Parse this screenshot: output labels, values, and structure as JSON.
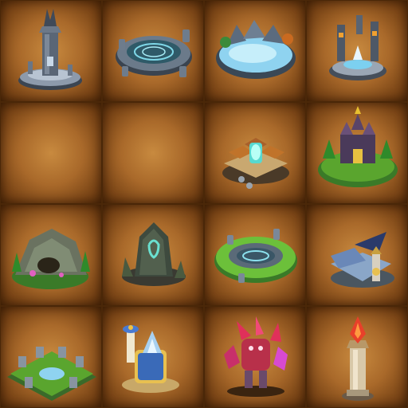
{
  "buildings": [
    {
      "icon": "stone-tower-icon"
    },
    {
      "icon": "summoning-circle-icon"
    },
    {
      "icon": "frozen-lake-icon"
    },
    {
      "icon": "crystal-altar-icon"
    },
    {
      "icon": "empty-slot"
    },
    {
      "icon": "empty-slot"
    },
    {
      "icon": "portal-temple-icon"
    },
    {
      "icon": "dark-castle-icon"
    },
    {
      "icon": "mossy-cave-icon"
    },
    {
      "icon": "rune-monolith-icon"
    },
    {
      "icon": "grass-summoning-circle-icon"
    },
    {
      "icon": "sky-ship-icon"
    },
    {
      "icon": "fountain-garden-icon"
    },
    {
      "icon": "crystal-shrine-icon"
    },
    {
      "icon": "crystal-golem-icon"
    },
    {
      "icon": "flame-obelisk-icon"
    }
  ],
  "colors": {
    "tile_light": "#c88a3f",
    "tile_dark": "#5a300c",
    "grass": "#5aa52e",
    "stone": "#7d8a99",
    "water": "#8fd3f0",
    "crystal_red": "#e0305a"
  }
}
